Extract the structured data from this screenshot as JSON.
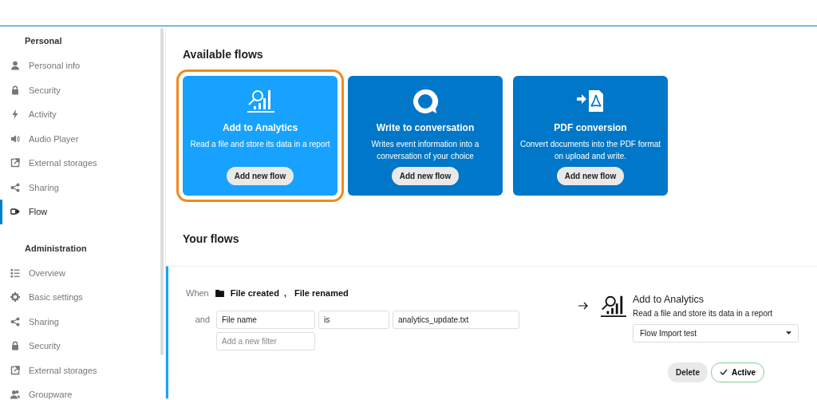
{
  "sidebar": {
    "sections": [
      {
        "heading": "Personal",
        "items": [
          {
            "label": "Personal info",
            "selected": false
          },
          {
            "label": "Security",
            "selected": false
          },
          {
            "label": "Activity",
            "selected": false
          },
          {
            "label": "Audio Player",
            "selected": false
          },
          {
            "label": "External storages",
            "selected": false
          },
          {
            "label": "Sharing",
            "selected": false
          },
          {
            "label": "Flow",
            "selected": true
          }
        ]
      },
      {
        "heading": "Administration",
        "items": [
          {
            "label": "Overview",
            "selected": false
          },
          {
            "label": "Basic settings",
            "selected": false
          },
          {
            "label": "Sharing",
            "selected": false
          },
          {
            "label": "Security",
            "selected": false
          },
          {
            "label": "External storages",
            "selected": false
          },
          {
            "label": "Groupware",
            "selected": false
          }
        ]
      }
    ]
  },
  "available_flows": {
    "title": "Available flows",
    "cards": [
      {
        "title": "Add to Analytics",
        "description": "Read a file and store its data in a report",
        "button": "Add new flow",
        "selected": true
      },
      {
        "title": "Write to conversation",
        "description": "Writes event information into a conversation of your choice",
        "button": "Add new flow",
        "selected": false
      },
      {
        "title": "PDF conversion",
        "description": "Convert documents into the PDF format on upload and write.",
        "button": "Add new flow",
        "selected": false
      }
    ]
  },
  "your_flows": {
    "title": "Your flows",
    "rules": [
      {
        "when_label": "When",
        "triggers": [
          "File created",
          "File renamed"
        ],
        "separator": ",",
        "and_label": "and",
        "filters": [
          {
            "field": "File name",
            "operator": "is",
            "value": "analytics_update.txt"
          }
        ],
        "new_filter": {
          "placeholder": "Add a new filter"
        },
        "action": {
          "title": "Add to Analytics",
          "description": "Read a file and store its data in a report",
          "select": "Flow Import test"
        },
        "delete_button": "Delete",
        "active_button": "Active",
        "active": true
      }
    ]
  }
}
